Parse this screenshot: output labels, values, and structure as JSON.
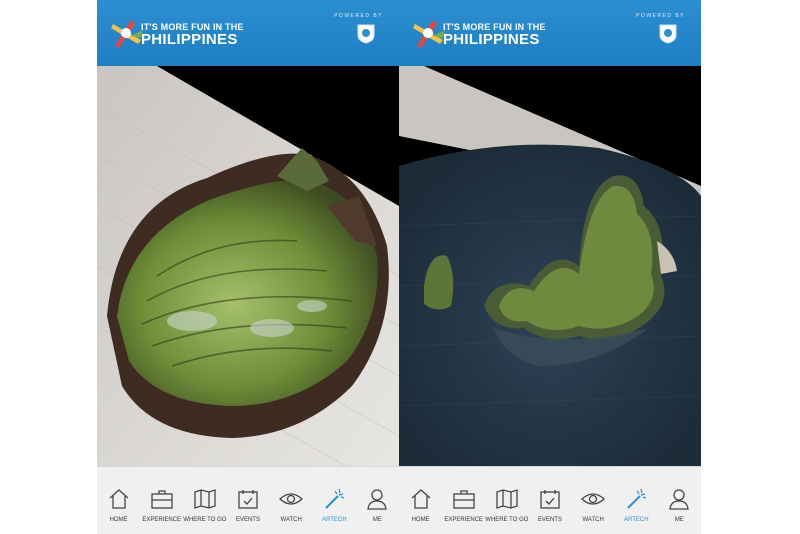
{
  "header": {
    "logo_top": "IT'S MORE FUN IN THE",
    "logo_main": "PHILIPPINES",
    "powered_by": "POWERED BY"
  },
  "nav": {
    "items": [
      {
        "label": "HOME",
        "icon": "home-icon"
      },
      {
        "label": "EXPERIENCE",
        "icon": "briefcase-icon"
      },
      {
        "label": "WHERE TO GO",
        "icon": "map-icon"
      },
      {
        "label": "EVENTS",
        "icon": "calendar-icon"
      },
      {
        "label": "WATCH",
        "icon": "eye-icon"
      },
      {
        "label": "ARTECH",
        "icon": "magic-wand-icon"
      },
      {
        "label": "ME",
        "icon": "user-icon"
      }
    ],
    "active": "ARTECH"
  },
  "colors": {
    "header": "#2a8fd0",
    "active": "#2a8fd0",
    "navbar": "#f0f0f0"
  }
}
